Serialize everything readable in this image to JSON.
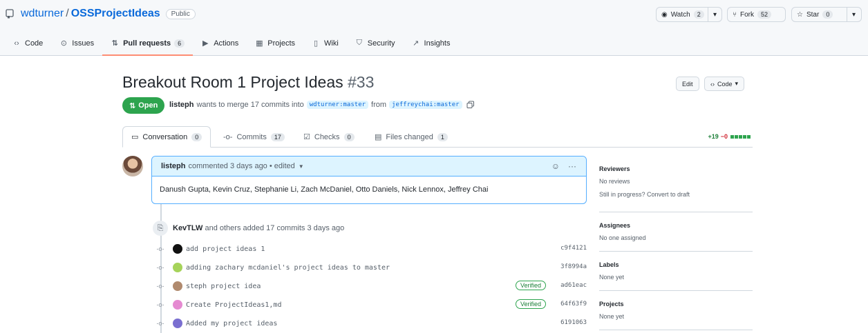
{
  "repo": {
    "owner": "wdturner",
    "slash": "/",
    "name": "OSSProjectIdeas",
    "visibility": "Public",
    "watch_label": "Watch",
    "watch_count": "2",
    "fork_label": "Fork",
    "fork_count": "52",
    "star_label": "Star",
    "star_count": "0"
  },
  "nav": {
    "code": "Code",
    "issues": "Issues",
    "pulls": "Pull requests",
    "pulls_count": "6",
    "actions": "Actions",
    "projects": "Projects",
    "wiki": "Wiki",
    "security": "Security",
    "insights": "Insights"
  },
  "pr": {
    "title": "Breakout Room 1 Project Ideas",
    "number": "#33",
    "edit_label": "Edit",
    "code_label": "Code",
    "state": "Open",
    "author": "listeph",
    "merge_text": "wants to merge 17 commits into",
    "base_branch": "wdturner:master",
    "from_text": "from",
    "head_branch": "jeffreychai:master"
  },
  "tabs": {
    "conversation": "Conversation",
    "conversation_count": "0",
    "commits": "Commits",
    "commits_count": "17",
    "checks": "Checks",
    "checks_count": "0",
    "files": "Files changed",
    "files_count": "1",
    "additions": "+19",
    "deletions": "−0"
  },
  "comment": {
    "author": "listeph",
    "meta": "commented 3 days ago • edited",
    "body": "Danush Gupta, Kevin Cruz, Stephanie Li, Zach McDaniel, Otto Daniels, Nick Lennox, Jeffrey Chai"
  },
  "push": {
    "author": "KevTLW",
    "text": "and others added 17 commits 3 days ago"
  },
  "commits": [
    {
      "message": "add project ideas 1",
      "sha": "c9f4121",
      "verified": "",
      "avatar_color": "#111111"
    },
    {
      "message": "adding zachary mcdaniel's project ideas to master",
      "sha": "3f8994a",
      "verified": "",
      "avatar_color": "#a6d35a"
    },
    {
      "message": "steph project idea",
      "sha": "ad61eac",
      "verified": "Verified",
      "avatar_color": "#b08a6e"
    },
    {
      "message": "Create ProjectIdeas1,md",
      "sha": "64f63f9",
      "verified": "Verified",
      "avatar_color": "#e58ad1"
    },
    {
      "message": "Added my project ideas",
      "sha": "6191063",
      "verified": "",
      "avatar_color": "#7a6fd0"
    }
  ],
  "sidebar": {
    "reviewers_h": "Reviewers",
    "reviewers_v": "No reviews",
    "draft_text": "Still in progress? Convert to draft",
    "assignees_h": "Assignees",
    "assignees_v": "No one assigned",
    "labels_h": "Labels",
    "labels_v": "None yet",
    "projects_h": "Projects",
    "projects_v": "None yet"
  },
  "colors": {
    "accent_blue": "#0969da",
    "open_green": "#2da44e",
    "tab_underline": "#fd8c73"
  }
}
